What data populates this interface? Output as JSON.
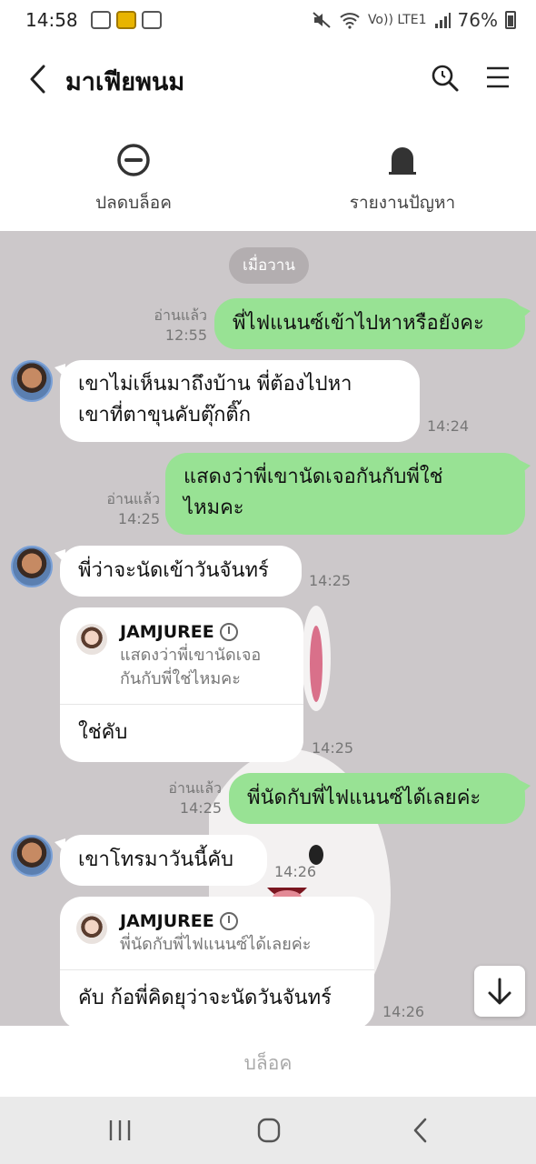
{
  "status": {
    "time": "14:58",
    "net_label": "Vo)) LTE1",
    "battery": "76%"
  },
  "header": {
    "title": "มาเฟียพนม"
  },
  "actions": {
    "unblock": "ปลดบล็อค",
    "report": "รายงานปัญหา"
  },
  "chat": {
    "date": "เมื่อวาน",
    "m1": {
      "text": "พี่ไฟแนนซ์เข้าไปหาหรือยังคะ",
      "read": "อ่านแล้ว",
      "time": "12:55"
    },
    "m2": {
      "line1": "เขาไม่เห็นมาถึงบ้าน พี่ต้องไปหา",
      "line2": "เขาที่ตาขุนคับตุ๊กติ๊ก",
      "time": "14:24"
    },
    "m3": {
      "line1": "แสดงว่าพี่เขานัดเจอกันกับพี่ใช่",
      "line2": "ไหมคะ",
      "read": "อ่านแล้ว",
      "time": "14:25"
    },
    "m4": {
      "text": "พี่ว่าจะนัดเข้าวันจันทร์",
      "time": "14:25"
    },
    "m5": {
      "quote_name": "JAMJUREE",
      "quote_line1": "แสดงว่าพี่เขานัดเจอ",
      "quote_line2": "กันกับพี่ใช่ไหมคะ",
      "reply": "ใช่คับ",
      "time": "14:25"
    },
    "m6": {
      "text": "พี่นัดกับพี่ไฟแนนซ์ได้เลยค่ะ",
      "read": "อ่านแล้ว",
      "time": "14:25"
    },
    "m7": {
      "text": "เขาโทรมาวันนี้คับ",
      "time": "14:26"
    },
    "m8": {
      "quote_name": "JAMJUREE",
      "quote_text": "พี่นัดกับพี่ไฟแนนซ์ได้เลยค่ะ",
      "reply": "คับ ก้อพี่คิดยุว่าจะนัดวันจันทร์",
      "time": "14:26"
    }
  },
  "footer": {
    "block": "บล็อค"
  }
}
